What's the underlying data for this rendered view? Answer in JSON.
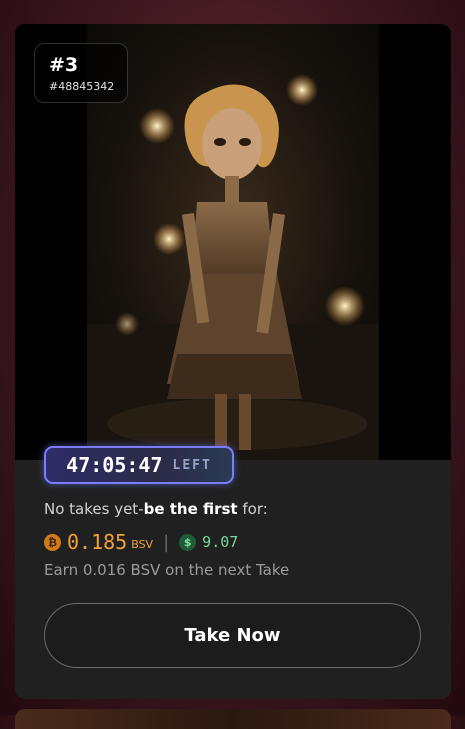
{
  "card": {
    "rank": "#3",
    "id": "#48845342",
    "artwork_alt": "Paper doll figure with curly blonde hair on a night street",
    "timer": {
      "value": "47:05:47",
      "suffix": "LEFT"
    },
    "takes": {
      "prefix": "No takes yet-",
      "emphasis": "be the first",
      "suffix": " for:"
    },
    "price": {
      "bsv_icon": "bitcoin-icon",
      "bsv_value": "0.185",
      "bsv_unit": "BSV",
      "separator": "|",
      "usd_icon": "dollar-icon",
      "usd_value": "9.07"
    },
    "earn_text": "Earn 0.016 BSV on the next Take",
    "take_button": "Take Now"
  },
  "colors": {
    "background": "#3f1820",
    "card": "#202020",
    "timer_border": "#7b7cff",
    "bsv": "#f0a23a",
    "usd": "#75d79a"
  }
}
